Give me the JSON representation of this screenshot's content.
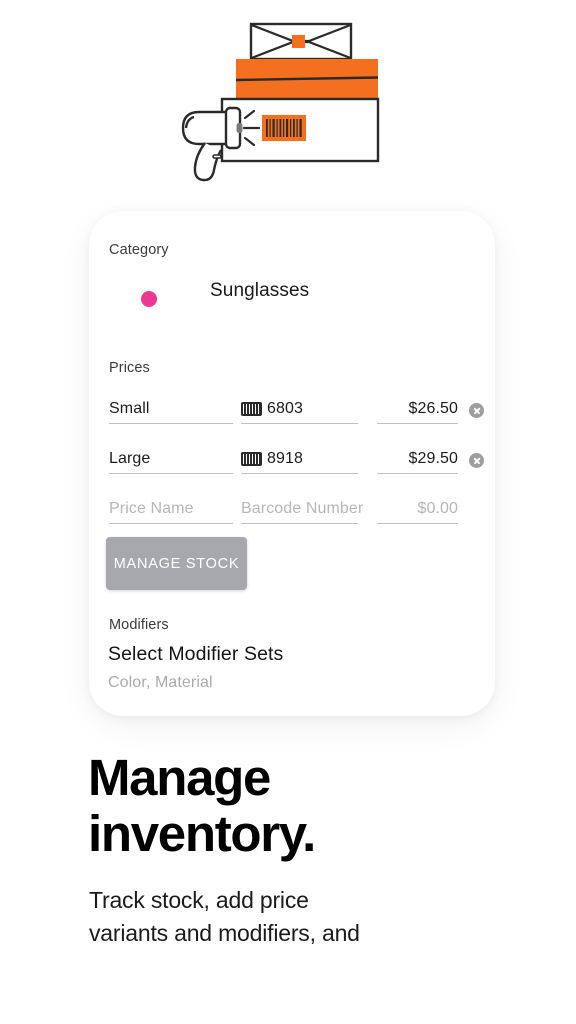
{
  "illustration": {
    "name": "inventory-scanner-boxes-illustration",
    "colors": {
      "orange": "#f4701e",
      "outline": "#2b2b2b",
      "paper": "#ffffff"
    },
    "parts": [
      "envelope-box-lid",
      "orange-box",
      "white-box",
      "orange-barcode-label",
      "barcode-scanner-gun",
      "scan-rays"
    ]
  },
  "card": {
    "category": {
      "label": "Category",
      "value": "Sunglasses",
      "dot_color": "#ea3a90"
    },
    "prices": {
      "label": "Prices",
      "rows": [
        {
          "name": "Small",
          "barcode": "6803",
          "price": "$26.50",
          "has_clear": true,
          "placeholder": false
        },
        {
          "name": "Large",
          "barcode": "8918",
          "price": "$29.50",
          "has_clear": true,
          "placeholder": false
        },
        {
          "name": "Price Name",
          "barcode": "Barcode Number",
          "price": "$0.00",
          "has_clear": false,
          "placeholder": true
        }
      ]
    },
    "manage_stock_label": "MANAGE STOCK",
    "modifiers": {
      "label": "Modifiers",
      "select_label": "Select Modifier Sets",
      "values": "Color, Material"
    }
  },
  "marketing": {
    "headline_line_1": "Manage",
    "headline_line_2": "inventory.",
    "subcopy_line_1": "Track stock, add price",
    "subcopy_line_2": "variants and modifiers, and"
  }
}
